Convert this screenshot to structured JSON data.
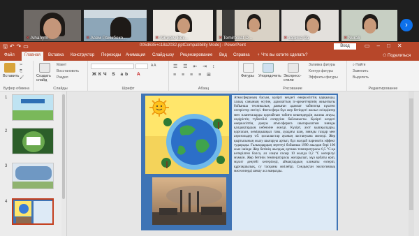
{
  "participants": [
    {
      "name": "Aihanym"
    },
    {
      "name": "Асем Рахмбеко..."
    },
    {
      "name": "Айгерім Бек..."
    },
    {
      "name": "Temirbolat D..."
    },
    {
      "name": "зарина 9а"
    },
    {
      "name": "Nurali"
    }
  ],
  "title_bar": {
    "doc_title": "005d635+c18a2032.pptCompatibility Mode] - PowerPoint",
    "signin": "Вход"
  },
  "tabs": [
    {
      "label": "Файл"
    },
    {
      "label": "Главная",
      "active": true
    },
    {
      "label": "Вставка"
    },
    {
      "label": "Конструктор"
    },
    {
      "label": "Переходы"
    },
    {
      "label": "Анимация"
    },
    {
      "label": "Слайд-шоу"
    },
    {
      "label": "Рецензирование"
    },
    {
      "label": "Вид"
    },
    {
      "label": "Справка"
    },
    {
      "label": "Что вы хотите сделать?"
    }
  ],
  "share_label": "Поделиться",
  "ribbon": {
    "groups": [
      {
        "label": "Буфер обмена"
      },
      {
        "label": "Слайды"
      },
      {
        "label": "Шрифт"
      },
      {
        "label": "Абзац"
      },
      {
        "label": "Рисование"
      },
      {
        "label": "Редактирование"
      }
    ],
    "paste": "Вставить",
    "new_slide": "Создать слайд",
    "layout": "Макет",
    "reset": "Восстановить",
    "section": "Раздел",
    "shapes": "Фигуры",
    "arrange": "Упорядочить",
    "quick_styles": "Экспресс-стили",
    "fill": "Заливка фигуры",
    "outline": "Контур фигуры",
    "effects": "Эффекты фигуры",
    "find": "Найти",
    "replace": "Заменить",
    "select": "Выделить"
  },
  "slides": [
    {
      "num": "1"
    },
    {
      "num": "2"
    },
    {
      "num": "3"
    },
    {
      "num": "4",
      "active": true
    }
  ],
  "slide": {
    "text": "Атмосфераның басым, қазіргі кездегі өнеркәсіптің қарқынды, халық санының өсуіне, адамзаттың іс-әрекеттерінің жиынтығы бойынша техникалық дамыған адамзат табиғатқа күштеп өзгерістер енгізуі. Фитосфера бұл жер бетіндегі жасыл өсімдіктер мен планеталарды қорғайтын табиғи кешендердің жалпы атауы, өндірістің түбегейлі өзгеруіне байланысты. Қазіргі кездегі өнеркәсіптің дамуы атмосфераға шығарылатын зиянды қалдықтардың көбеюіне әкелді. Күкірт, азот қышқылдары, қорғасын, көмірқышқыл газы, ауадағы шаң, зиянды газдар мен аэрозольдер т.б. қосылыстар ауаның ластануына әкеледі. Жер қыртысының жылу шығаруы артып, бұл жағдай парниктік эффект тудырады. Ғалымдардың зерттеуі бойынша 1990 жылдан бері 100 жыл ішінде Жер бетінің жылдық орташа температурасы 0,5 °С-қа көтерілген болса, ал соңғы ғасыр 10 жылда 0,2 °С көтерілуі мүмкін. Жер бетінің температурасы жоғарылап, мұз қабаты еріп, мұхит деңгейі көтеріледі, аймақтардың климаты өзгеріп, құрғақшылық, су тасқыны жиілейді. Сондықтан экологиялық мәселелерді шешу аса маңызды."
  },
  "colors": {
    "accent": "#b7472a",
    "zoom_blue": "#0e71eb",
    "slide_bg": "#3f74b5",
    "text_panel": "#ddeaf6",
    "sun_bg": "#ffe66b"
  }
}
